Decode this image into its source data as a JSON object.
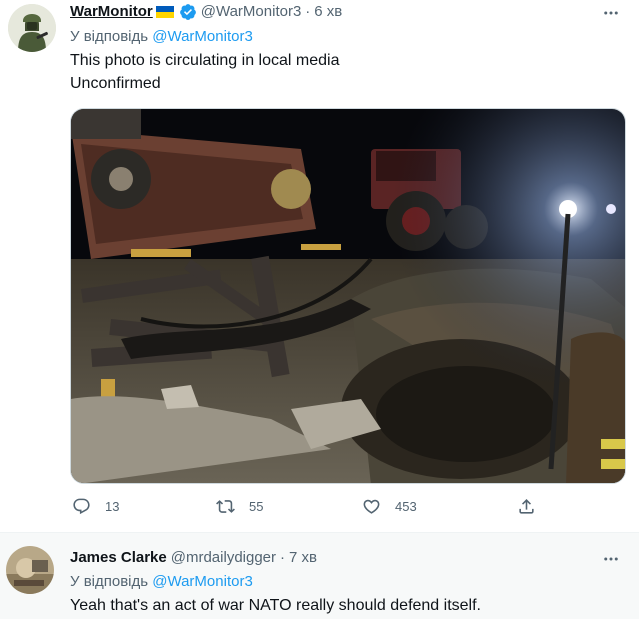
{
  "tweet1": {
    "display_name": "WarMonitor",
    "handle": "@WarMonitor3",
    "separator": "·",
    "time": "6 хв",
    "reply_prefix": "У відповідь",
    "reply_target": "@WarMonitor3",
    "text_line1": "This photo is circulating in local media",
    "text_line2": "Unconfirmed",
    "more_label": "···",
    "media_subject": "night scene: overturned trailer and tractor beside blast crater, rescuer with flashlight",
    "replies": "13",
    "retweets": "55",
    "likes": "453",
    "icons": [
      "flag-ukraine-icon",
      "verified-badge-icon",
      "more-icon",
      "reply-icon",
      "retweet-icon",
      "like-icon",
      "share-icon"
    ]
  },
  "tweet2": {
    "display_name": "James Clarke",
    "handle": "@mrdailydigger",
    "separator": "·",
    "time": "7 хв",
    "reply_prefix": "У відповідь",
    "reply_target": "@WarMonitor3",
    "text": "Yeah that's an act of war NATO really should defend itself.",
    "more_label": "···"
  },
  "colors": {
    "text": "#0f1419",
    "secondary": "#536471",
    "link": "#1d9bf0",
    "verified": "#1d9bf0",
    "flag_blue": "#005bbb",
    "flag_yellow": "#ffd500"
  }
}
